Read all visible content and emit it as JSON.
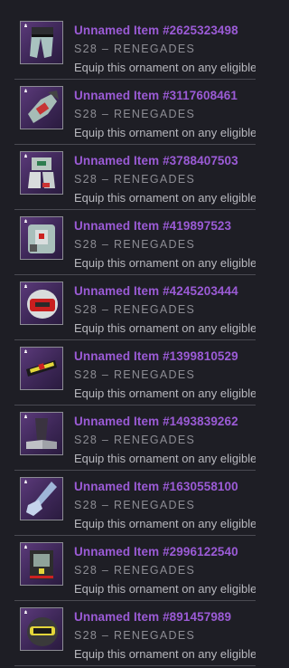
{
  "items": [
    {
      "title": "Unnamed Item #2625323498",
      "season": "S28 – RENEGADES",
      "description": "Equip this ornament on any eligible L",
      "icon": "legs-armor-icon"
    },
    {
      "title": "Unnamed Item #3117608461",
      "season": "S28 – RENEGADES",
      "description": "Equip this ornament on any eligible L",
      "icon": "gauntlets-armor-icon"
    },
    {
      "title": "Unnamed Item #3788407503",
      "season": "S28 – RENEGADES",
      "description": "Equip this ornament on any eligible L",
      "icon": "boots-armor-icon"
    },
    {
      "title": "Unnamed Item #419897523",
      "season": "S28 – RENEGADES",
      "description": "Equip this ornament on any eligible L",
      "icon": "chest-armor-icon"
    },
    {
      "title": "Unnamed Item #4245203444",
      "season": "S28 – RENEGADES",
      "description": "Equip this ornament on any eligible L",
      "icon": "helmet-armor-icon"
    },
    {
      "title": "Unnamed Item #1399810529",
      "season": "S28 – RENEGADES",
      "description": "Equip this ornament on any eligible L",
      "icon": "class-item-belt-icon"
    },
    {
      "title": "Unnamed Item #1493839262",
      "season": "S28 – RENEGADES",
      "description": "Equip this ornament on any eligible L",
      "icon": "legs-armor-icon"
    },
    {
      "title": "Unnamed Item #1630558100",
      "season": "S28 – RENEGADES",
      "description": "Equip this ornament on any eligible L",
      "icon": "gauntlets-armor-icon"
    },
    {
      "title": "Unnamed Item #2996122540",
      "season": "S28 – RENEGADES",
      "description": "Equip this ornament on any eligible L",
      "icon": "chest-armor-icon"
    },
    {
      "title": "Unnamed Item #891457989",
      "season": "S28 – RENEGADES",
      "description": "Equip this ornament on any eligible L",
      "icon": "helmet-armor-icon"
    }
  ],
  "colors": {
    "title": "#9b5bd6",
    "season": "#8d8d94",
    "description": "#b8b8be",
    "background": "#1e1e25",
    "icon_bg": "#4a2f66"
  }
}
